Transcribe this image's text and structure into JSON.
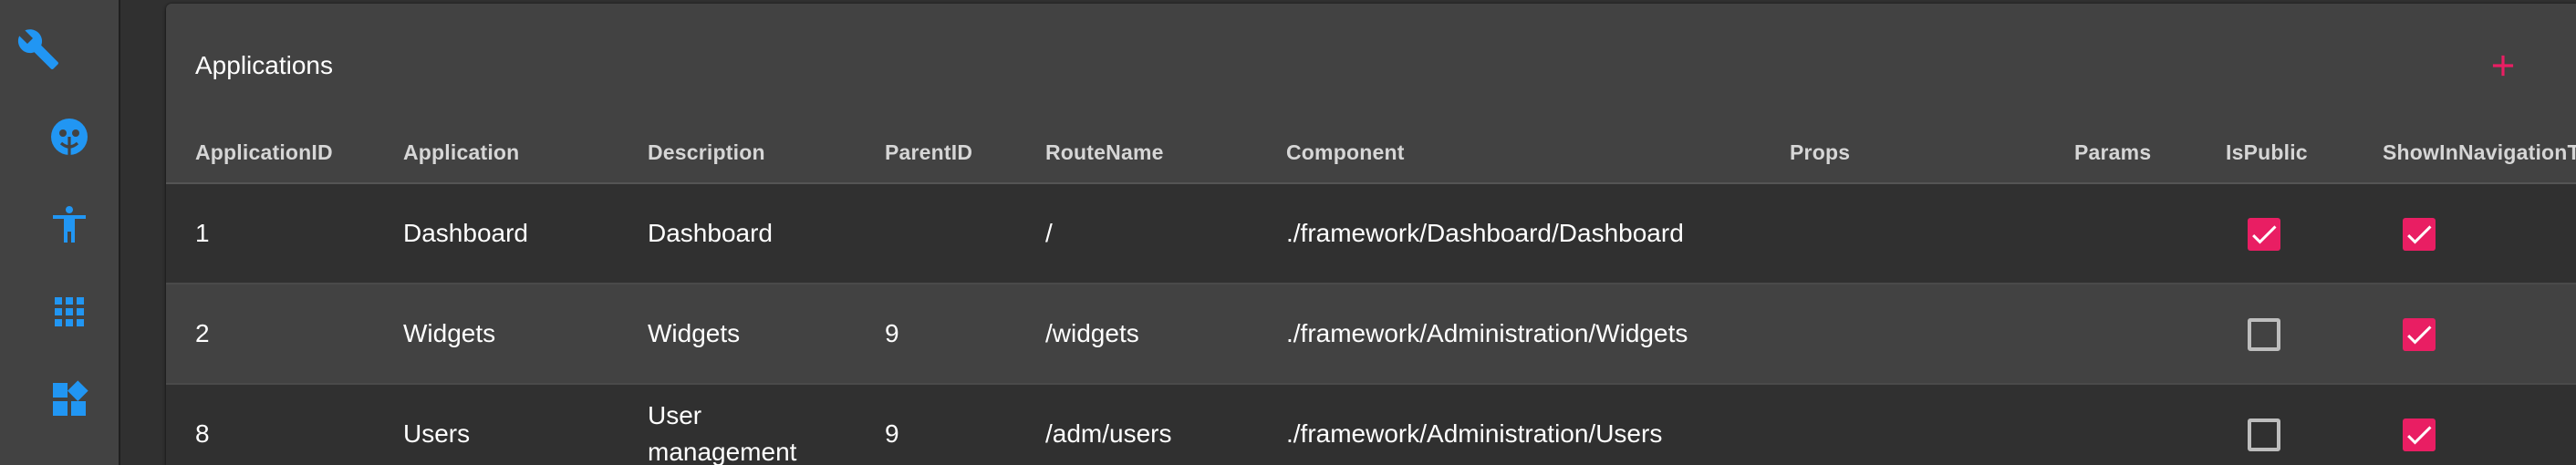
{
  "colors": {
    "accent": "#e91e63",
    "sidebar_icon": "#2196f3",
    "background": "#303030",
    "surface": "#424242"
  },
  "sidebar": {
    "items": [
      {
        "icon": "wrench-icon"
      },
      {
        "icon": "face-icon"
      },
      {
        "icon": "accessibility-icon"
      },
      {
        "icon": "apps-grid-icon"
      },
      {
        "icon": "widgets-icon"
      }
    ]
  },
  "card": {
    "title": "Applications",
    "add_icon": "plus-icon"
  },
  "table": {
    "columns": [
      "ApplicationID",
      "Application",
      "Description",
      "ParentID",
      "RouteName",
      "Component",
      "Props",
      "Params",
      "IsPublic",
      "ShowInNavigationT"
    ],
    "rows": [
      {
        "application_id": "1",
        "application": "Dashboard",
        "description": "Dashboard",
        "parent_id": "",
        "route_name": "/",
        "component": "./framework/Dashboard/Dashboard",
        "props": "",
        "params": "",
        "is_public": true,
        "show_in_navigation": true
      },
      {
        "application_id": "2",
        "application": "Widgets",
        "description": "Widgets",
        "parent_id": "9",
        "route_name": "/widgets",
        "component": "./framework/Administration/Widgets",
        "props": "",
        "params": "",
        "is_public": false,
        "show_in_navigation": true
      },
      {
        "application_id": "8",
        "application": "Users",
        "description": "User management",
        "parent_id": "9",
        "route_name": "/adm/users",
        "component": "./framework/Administration/Users",
        "props": "",
        "params": "",
        "is_public": false,
        "show_in_navigation": true
      }
    ]
  }
}
